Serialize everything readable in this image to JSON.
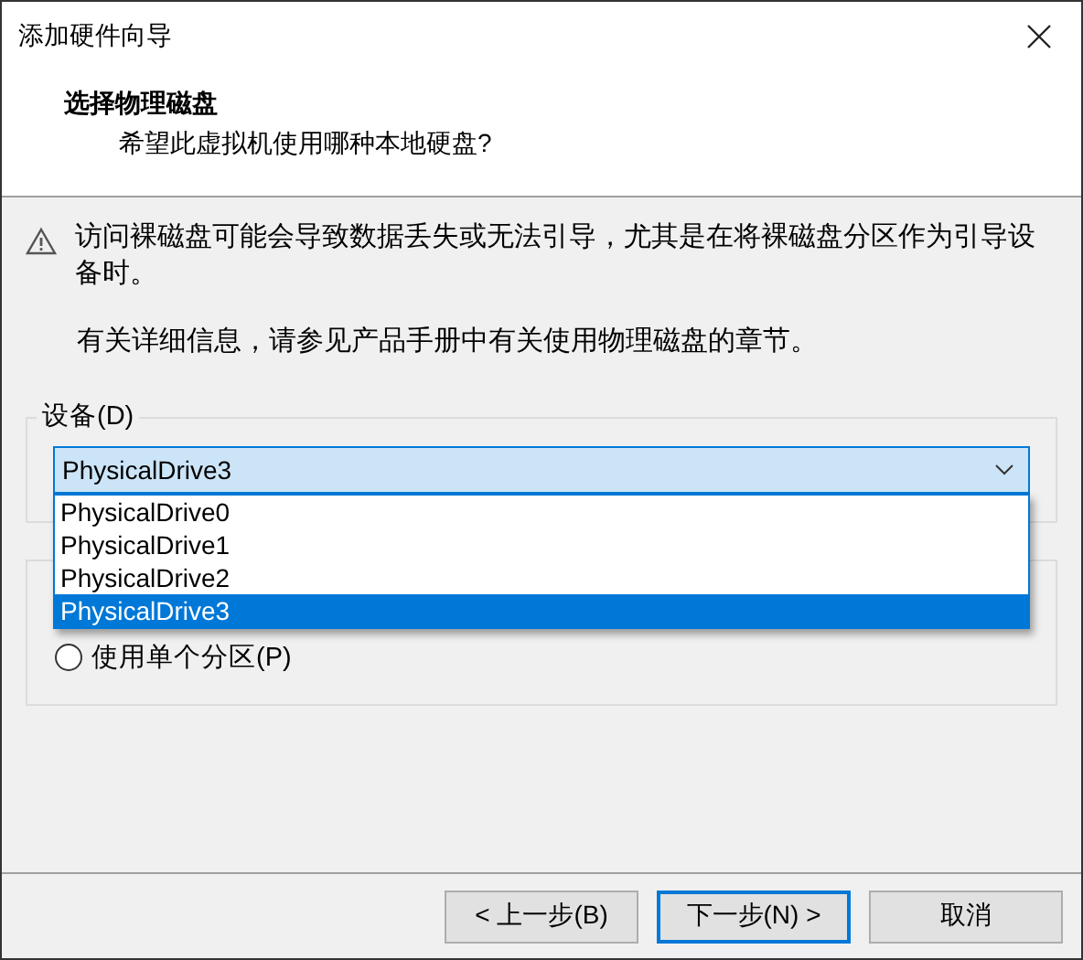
{
  "window": {
    "title": "添加硬件向导"
  },
  "header": {
    "title": "选择物理磁盘",
    "subtitle": "希望此虚拟机使用哪种本地硬盘?"
  },
  "warning": "访问裸磁盘可能会导致数据丢失或无法引导，尤其是在将裸磁盘分区作为引导设备时。",
  "info": "有关详细信息，请参见产品手册中有关使用物理磁盘的章节。",
  "device_group": {
    "label": "设备(D)",
    "combo": {
      "value": "PhysicalDrive3",
      "expanded": true
    },
    "options": [
      {
        "label": "PhysicalDrive0",
        "selected": false
      },
      {
        "label": "PhysicalDrive1",
        "selected": false
      },
      {
        "label": "PhysicalDrive2",
        "selected": false
      },
      {
        "label": "PhysicalDrive3",
        "selected": true
      }
    ]
  },
  "usage_group": {
    "options": [
      {
        "label": "使用单个分区(P)",
        "selected": false
      }
    ]
  },
  "buttons": [
    {
      "label": "< 上一步(B)",
      "default": false
    },
    {
      "label": "下一步(N) >",
      "default": true
    },
    {
      "label": "取消",
      "default": false
    }
  ]
}
